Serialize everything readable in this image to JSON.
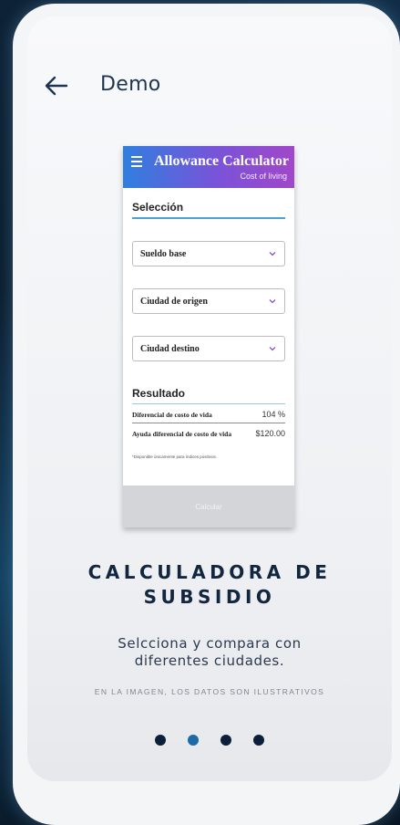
{
  "header": {
    "title": "Demo",
    "back_icon": "arrow-left-icon"
  },
  "preview": {
    "app_title": "Allowance Calculator",
    "app_subtitle": "Cost of living",
    "menu_icon": "hamburger-menu-icon",
    "selection_title": "Selección",
    "selects": [
      {
        "label": "Sueldo base"
      },
      {
        "label": "Ciudad de origen"
      },
      {
        "label": "Ciudad destino"
      }
    ],
    "result_title": "Resultado",
    "results": [
      {
        "label": "Diferencial de costo de vida",
        "value": "104 %"
      },
      {
        "label": "Ayuda diferencial de costo de vida",
        "value": "$120.00"
      }
    ],
    "footnote": "*Disponible únicamente para índices positivos.",
    "button_label": "Calcular",
    "colors": {
      "header_start": "#2f7fe0",
      "header_end": "#a147c8",
      "accent_line": "#4aa3d4"
    }
  },
  "onboarding": {
    "heading_line1": "CALCULADORA DE",
    "heading_line2": "SUBSIDIO",
    "description_line1": "Selcciona y compara con",
    "description_line2": "diferentes ciudades.",
    "disclaimer": "EN LA IMAGEN, LOS DATOS SON ILUSTRATIVOS",
    "page_indicator": {
      "total": 4,
      "active_index": 1
    },
    "colors": {
      "heading": "#13263f",
      "dot": "#0c1f3a",
      "dot_active": "#1d6aa8"
    }
  }
}
